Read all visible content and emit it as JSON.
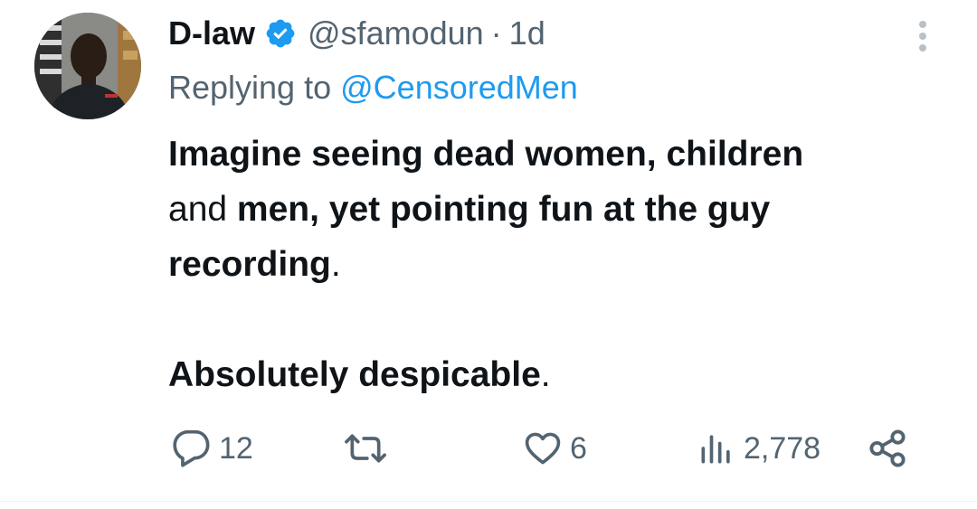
{
  "tweet": {
    "display_name": "D-law",
    "verified": true,
    "handle": "@sfamodun",
    "separator": "·",
    "timestamp": "1d",
    "replying_prefix": "Replying to",
    "replying_to": "@CensoredMen",
    "body": {
      "line1_bold": "Imagine seeing dead women, children",
      "line2_regular": "and",
      "line2_bold": " men, yet pointing fun at the guy",
      "line3_bold": "recording",
      "line3_regular": ".",
      "line4_bold": "Absolutely despicable",
      "line4_regular": "."
    },
    "actions": {
      "reply_count": "12",
      "retweet_count": "",
      "like_count": "6",
      "views_count": "2,778"
    }
  },
  "colors": {
    "text_primary": "#0f1419",
    "text_secondary": "#536471",
    "link": "#1d9bf0",
    "verified_badge": "#1d9bf0",
    "divider": "#eff3f4"
  },
  "icons": {
    "more": "more-vertical-icon",
    "reply": "reply-bubble-icon",
    "retweet": "retweet-icon",
    "like": "heart-icon",
    "views": "bar-chart-icon",
    "share": "share-icon",
    "verified": "verified-badge-icon"
  }
}
